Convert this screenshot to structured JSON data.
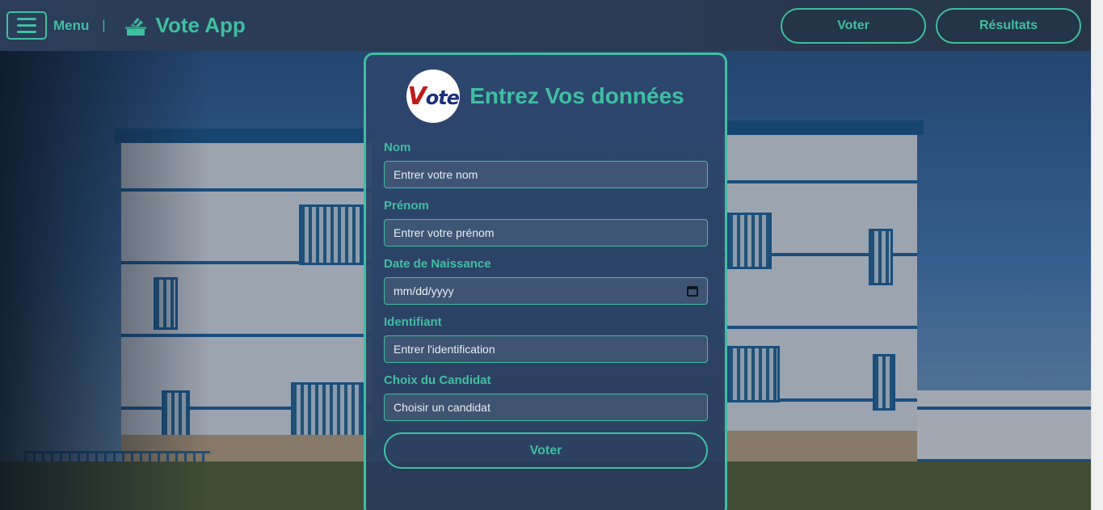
{
  "topbar": {
    "menu_label": "Menu",
    "separator": "|",
    "brand_name": "Vote App",
    "nav": [
      {
        "label": "Voter"
      },
      {
        "label": "Résultats"
      }
    ]
  },
  "form": {
    "logo_text": "Vote",
    "title": "Entrez Vos données",
    "fields": [
      {
        "label": "Nom",
        "placeholder": "Entrer votre nom"
      },
      {
        "label": "Prénom",
        "placeholder": "Entrer votre prénom"
      },
      {
        "label": "Date de Naissance",
        "placeholder": "mm/dd/yyyy"
      },
      {
        "label": "Identifiant",
        "placeholder": "Entrer l'identification"
      },
      {
        "label": "Choix du Candidat",
        "placeholder": "Choisir un candidat"
      }
    ],
    "submit_label": "Voter"
  },
  "colors": {
    "accent": "#3fbfa0",
    "navbar": "#2b3d58",
    "card": "#2e466e"
  },
  "icons": {
    "menu": "hamburger-icon",
    "brand": "ballot-box-icon",
    "date": "calendar-icon"
  }
}
